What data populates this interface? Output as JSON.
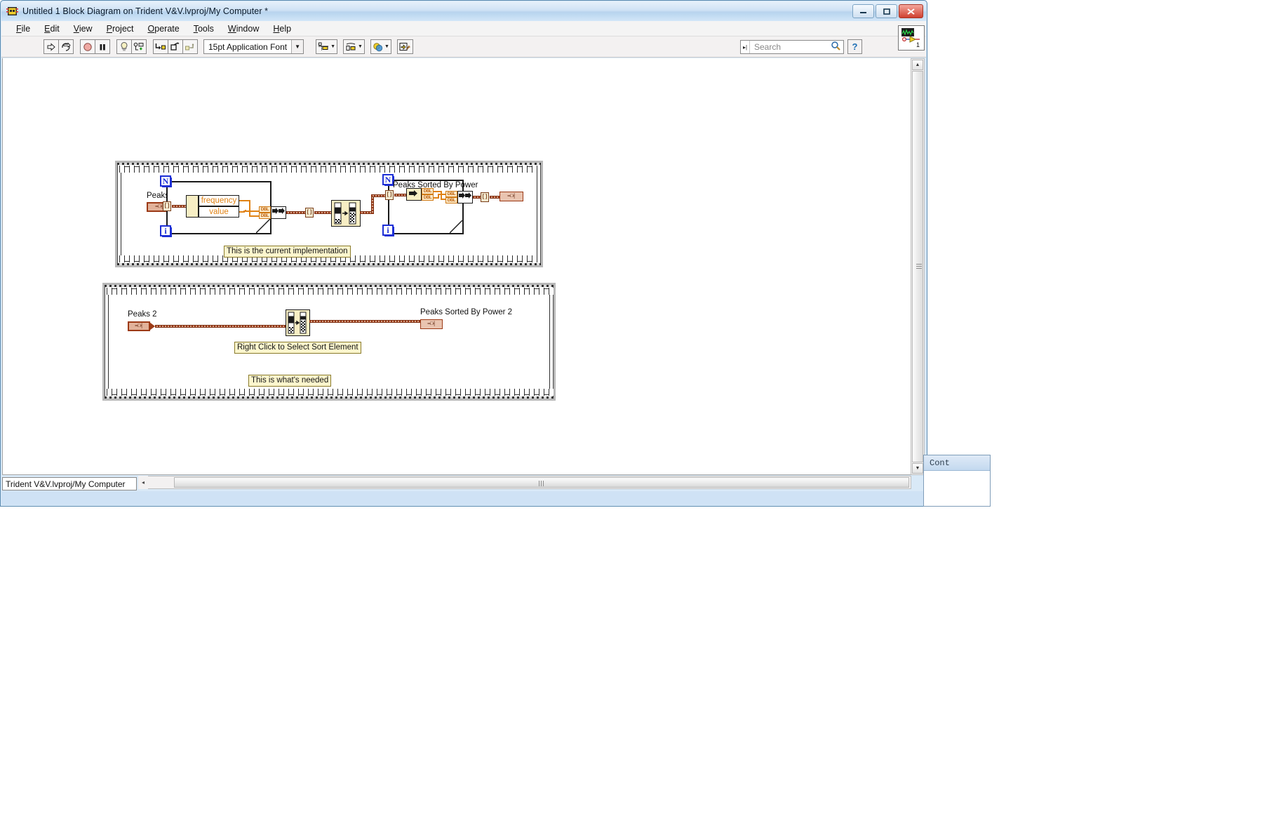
{
  "window": {
    "title": "Untitled 1 Block Diagram on Trident V&V.lvproj/My Computer *",
    "icon": "labview-block-diagram-icon",
    "minimize": "—",
    "maximize": "□",
    "close": "✕"
  },
  "menu": {
    "items": [
      {
        "label": "File",
        "mnemonic": "F"
      },
      {
        "label": "Edit",
        "mnemonic": "E"
      },
      {
        "label": "View",
        "mnemonic": "V"
      },
      {
        "label": "Project",
        "mnemonic": "P"
      },
      {
        "label": "Operate",
        "mnemonic": "O"
      },
      {
        "label": "Tools",
        "mnemonic": "T"
      },
      {
        "label": "Window",
        "mnemonic": "W"
      },
      {
        "label": "Help",
        "mnemonic": "H"
      }
    ]
  },
  "toolbar": {
    "buttons": [
      {
        "name": "run-button",
        "icon": "run-arrow-icon",
        "tooltip": "Run"
      },
      {
        "name": "run-continuously-button",
        "icon": "run-continuously-icon",
        "tooltip": "Run Continuously"
      },
      {
        "name": "abort-button",
        "icon": "abort-stop-icon",
        "tooltip": "Abort Execution"
      },
      {
        "name": "pause-button",
        "icon": "pause-icon",
        "tooltip": "Pause"
      },
      {
        "name": "highlight-execution-button",
        "icon": "lightbulb-icon",
        "tooltip": "Highlight Execution"
      },
      {
        "name": "retain-wire-values-button",
        "icon": "retain-wire-values-icon",
        "tooltip": "Retain Wire Values"
      },
      {
        "name": "step-into-button",
        "icon": "step-into-icon",
        "tooltip": "Step Into"
      },
      {
        "name": "step-over-button",
        "icon": "step-over-icon",
        "tooltip": "Step Over"
      },
      {
        "name": "step-out-button",
        "icon": "step-out-icon",
        "tooltip": "Step Out"
      }
    ],
    "font_selector": {
      "value": "15pt Application Font",
      "arrow": "▼"
    },
    "align_objects": {
      "name": "align-objects-button",
      "icon": "align-objects-icon",
      "arrow": "▼"
    },
    "distribute_objects": {
      "name": "distribute-objects-button",
      "icon": "distribute-objects-icon",
      "arrow": "▼"
    },
    "reorder": {
      "name": "reorder-button",
      "icon": "reorder-icon",
      "arrow": "▼"
    },
    "clean_up_diagram": {
      "name": "clean-up-diagram-button",
      "icon": "clean-up-diagram-icon"
    }
  },
  "search": {
    "placeholder": "Search",
    "pin_icon": "pin-arrow-icon",
    "magnifier_icon": "magnifier-icon"
  },
  "help_button": {
    "label": "?",
    "icon": "question-mark-icon"
  },
  "vi_icon": {
    "name": "vi-icon-pane",
    "label": "1"
  },
  "statusbar": {
    "text": "Trident V&V.lvproj/My Computer",
    "arrow": "◂"
  },
  "palette_window": {
    "title": "Cont"
  },
  "diagram": {
    "structure_1": {
      "name": "current-implementation-structure",
      "comment": "This is the current implementation",
      "input_label": "Peaks",
      "output_label": "Peaks Sorted By Power",
      "loop1": {
        "count_terminal": "N",
        "iteration_terminal": "i",
        "tunnel_in": "[]",
        "tunnel_out": "[]",
        "unbundle_fields": [
          "frequency",
          "value"
        ],
        "bundle_types": [
          "DBL",
          "DBL"
        ]
      },
      "sort_node": {
        "name": "sort-1d-array-node",
        "arrow": "→"
      },
      "loop2": {
        "count_terminal": "N",
        "iteration_terminal": "i",
        "tunnel_in": "[]",
        "tunnel_out": "[]",
        "unbundle_types": [
          "DBL",
          "DBL"
        ],
        "bundle_types": [
          "DBL",
          "DBL"
        ]
      }
    },
    "structure_2": {
      "name": "whats-needed-structure",
      "input_label": "Peaks 2",
      "output_label": "Peaks Sorted By Power 2",
      "comment_sort": "Right Click to Select Sort Element",
      "comment_needed": "This is what's needed",
      "sort_node": {
        "name": "sort-1d-array-node-2",
        "arrow": "→"
      }
    },
    "terminal_glyph": "═□╡"
  },
  "colors": {
    "title_bar": "#cfe2f5",
    "canvas": "#ffffff",
    "wire_brown": "#9c3a16",
    "cluster_orange": "#e08214",
    "node_yellow": "#f7eec4",
    "comment_yellow": "#fcf6cd",
    "loop_blue": "#1d2fd6",
    "close_red": "#cf4030"
  }
}
